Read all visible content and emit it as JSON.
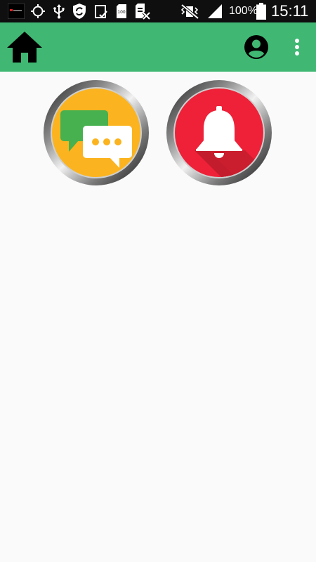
{
  "status_bar": {
    "battery_percent": "100%",
    "time": "15:11",
    "icons": [
      "app-notification-icon",
      "gps-icon",
      "usb-icon",
      "shield-sync-icon",
      "clipboard-check-icon",
      "sim-100-icon",
      "sd-card-icon",
      "vibrate-mute-icon",
      "signal-icon",
      "battery-icon"
    ],
    "colors": {
      "background": "#0f0f0f",
      "foreground": "#ffffff"
    }
  },
  "app_bar": {
    "home_icon": "home-icon",
    "account_icon": "account-circle-icon",
    "overflow_icon": "more-vert-icon",
    "background_color": "#40b874"
  },
  "buttons": [
    {
      "id": "chat",
      "icon": "chat-bubbles-icon",
      "color": "#fbb41f"
    },
    {
      "id": "alert",
      "icon": "bell-icon",
      "color": "#ee2138"
    }
  ],
  "page_background": "#fafafa"
}
